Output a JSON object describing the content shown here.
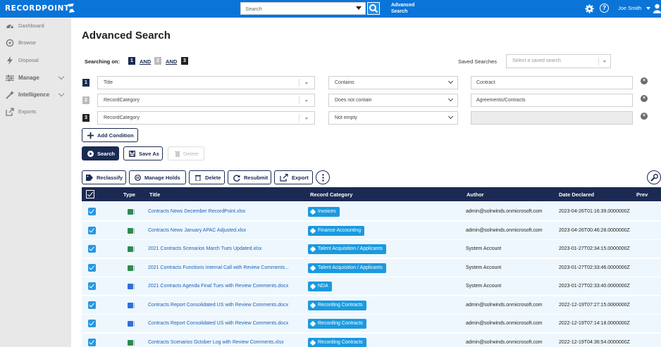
{
  "app": {
    "logo": "RECORDPOINT"
  },
  "topbar": {
    "search_placeholder": "Search",
    "advanced_link": "Advanced Search",
    "user_name": "Joe Smith"
  },
  "sidebar": {
    "items": [
      {
        "label": "Dashboard",
        "icon": "dashboard-icon"
      },
      {
        "label": "Browse",
        "icon": "browse-icon"
      },
      {
        "label": "Disposal",
        "icon": "disposal-icon"
      },
      {
        "label": "Manage",
        "icon": "manage-icon"
      },
      {
        "label": "Intelligence",
        "icon": "intelligence-icon"
      },
      {
        "label": "Exports",
        "icon": "exports-icon"
      }
    ]
  },
  "page": {
    "title": "Advanced Search",
    "searching_on_label": "Searching on:",
    "expression": [
      "1",
      "AND",
      "2",
      "AND",
      "3"
    ],
    "saved_searches_label": "Saved Searches",
    "saved_searches_placeholder": "Select a saved search"
  },
  "conditions": [
    {
      "num": "1",
      "field": "Title",
      "operator": "Contains",
      "value": "Contract",
      "value_enabled": true
    },
    {
      "num": "2",
      "field": "RecordCategory",
      "operator": "Does not contain",
      "value": "Agreements/Contracts",
      "value_enabled": true
    },
    {
      "num": "3",
      "field": "RecordCategory",
      "operator": "Not empty",
      "value": "",
      "value_enabled": false
    }
  ],
  "actions": {
    "add_condition": "Add Condition",
    "search": "Search",
    "save_as": "Save As",
    "delete": "Delete"
  },
  "toolbar": {
    "reclassify": "Reclassify",
    "manage_holds": "Manage Holds",
    "delete": "Delete",
    "resubmit": "Resubmit",
    "export": "Export"
  },
  "table": {
    "columns": [
      "Type",
      "Title",
      "Record Category",
      "Author",
      "Date Declared",
      "Prev"
    ],
    "rows": [
      {
        "type": "xlsx",
        "title": "Contracts News December RecordPoint.xlsx",
        "category": "Invoices",
        "author": "admin@solrwinds.onmicrosoft.com",
        "date": "2023-04-26T01:16:39.0000000Z"
      },
      {
        "type": "xlsx",
        "title": "Contracts News January APAC Adjusted.xlsx",
        "category": "Finance Accounting",
        "author": "admin@solrwinds.onmicrosoft.com",
        "date": "2023-04-26T00:46:28.0000000Z"
      },
      {
        "type": "xlsx",
        "title": "2021 Contracts Scenarios March Tues Updated.xlsx",
        "category": "Talent Acquisition / Applicants",
        "author": "System Account",
        "date": "2023-01-27T02:34:15.0000000Z"
      },
      {
        "type": "xlsx",
        "title": "2021 Contracts Functions Internal Call with Review Comments...",
        "category": "Talent Acquisition / Applicants",
        "author": "System Account",
        "date": "2023-01-27T02:33:46.0000000Z"
      },
      {
        "type": "docx",
        "title": "2021 Contracts Agenda Final Tues with Review Comments.docx",
        "category": "NDA",
        "author": "System Account",
        "date": "2023-01-27T02:33:40.0000000Z"
      },
      {
        "type": "docx",
        "title": "Contracts Report Consolidated US with Review Comments.docx",
        "category": "Recording Contracts",
        "author": "admin@solrwinds.onmicrosoft.com",
        "date": "2022-12-19T07:27:15.0000000Z"
      },
      {
        "type": "docx",
        "title": "Contracts Report Consolidated US with Review Comments.docx",
        "category": "Recording Contracts",
        "author": "admin@solrwinds.onmicrosoft.com",
        "date": "2022-12-19T07:14:18.0000000Z"
      },
      {
        "type": "xlsx",
        "title": "Contracts Scenarios October Log with Review Comments.xlsx",
        "category": "Recording Contracts",
        "author": "admin@solrwinds.onmicrosoft.com",
        "date": "2022-12-19T04:36:54.0000000Z"
      }
    ]
  },
  "colors": {
    "brand": "#0b74d8",
    "navy": "#1b2a53",
    "tag": "#1a9ae0",
    "row_bg": "#eef7fd"
  }
}
